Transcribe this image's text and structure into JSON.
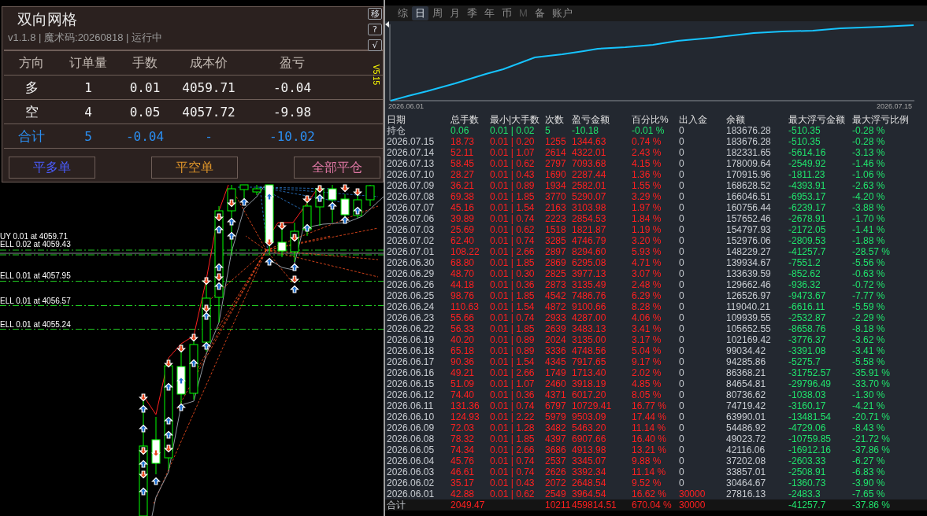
{
  "panel": {
    "title": "双向网格",
    "subtitle": "v1.1.8 | 魔术码:20260818 | 运行中",
    "side_buttons": [
      "移",
      "?",
      "√"
    ],
    "version_tag": "V5.15",
    "table": {
      "columns": [
        "方向",
        "订单量",
        "手数",
        "成本价",
        "盈亏"
      ],
      "rows": [
        {
          "kind": "position",
          "cells": [
            "多",
            "1",
            "0.01",
            "4059.71",
            "-0.04"
          ]
        },
        {
          "kind": "position",
          "cells": [
            "空",
            "4",
            "0.05",
            "4057.72",
            "-9.98"
          ]
        },
        {
          "kind": "total",
          "cells": [
            "合计",
            "5",
            "-0.04",
            "-",
            "-10.02"
          ]
        }
      ]
    },
    "buttons": [
      "平多单",
      "平空单",
      "全部平仓"
    ]
  },
  "chart": {
    "order_labels": [
      "UY 0.01 at 4059.71",
      "ELL 0.02 at 4059.43",
      "ELL 0.01 at 4057.95",
      "ELL 0.01 at 4056.57",
      "ELL 0.01 at 4055.24"
    ]
  },
  "stats": {
    "tabs": [
      {
        "label": "综",
        "selected": false,
        "disabled": false
      },
      {
        "label": "日",
        "selected": true,
        "disabled": false
      },
      {
        "label": "周",
        "selected": false,
        "disabled": false
      },
      {
        "label": "月",
        "selected": false,
        "disabled": false
      },
      {
        "label": "季",
        "selected": false,
        "disabled": false
      },
      {
        "label": "年",
        "selected": false,
        "disabled": false
      },
      {
        "label": "币",
        "selected": false,
        "disabled": false
      },
      {
        "label": "M",
        "selected": false,
        "disabled": true
      },
      {
        "label": "备",
        "selected": false,
        "disabled": false
      },
      {
        "label": "账户",
        "selected": false,
        "disabled": false
      }
    ],
    "equity_chart": {
      "x_start": "2026.06.01",
      "x_end": "2026.07.15"
    },
    "table": {
      "columns": [
        "日期",
        "总手数",
        "最小|大手数",
        "次数",
        "盈亏金额",
        "百分比%",
        "出入金",
        "余额",
        "最大浮亏金额",
        "最大浮亏比例"
      ],
      "rows": [
        {
          "kind": "open",
          "date": "持仓",
          "lots": "0.06",
          "lot_range": "0.01 | 0.02",
          "trades": "5",
          "pnl": "-10.18",
          "percent": "-0.01 %",
          "deposit": "0",
          "deposit_highlighted": false,
          "balance": "183676.28",
          "max_float_loss": "-510.35",
          "max_float_loss_pct": "-0.28 %"
        },
        {
          "kind": "day",
          "date": "2026.07.15",
          "lots": "18.73",
          "lot_range": "0.01 | 0.20",
          "trades": "1255",
          "pnl": "1344.63",
          "percent": "0.74 %",
          "deposit": "0",
          "deposit_highlighted": false,
          "balance": "183676.28",
          "max_float_loss": "-510.35",
          "max_float_loss_pct": "-0.28 %"
        },
        {
          "kind": "day",
          "date": "2026.07.14",
          "lots": "52.11",
          "lot_range": "0.01 | 1.07",
          "trades": "2614",
          "pnl": "4322.01",
          "percent": "2.43 %",
          "deposit": "0",
          "deposit_highlighted": false,
          "balance": "182331.65",
          "max_float_loss": "-5614.16",
          "max_float_loss_pct": "-3.13 %"
        },
        {
          "kind": "day",
          "date": "2026.07.13",
          "lots": "58.45",
          "lot_range": "0.01 | 0.62",
          "trades": "2797",
          "pnl": "7093.68",
          "percent": "4.15 %",
          "deposit": "0",
          "deposit_highlighted": false,
          "balance": "178009.64",
          "max_float_loss": "-2549.92",
          "max_float_loss_pct": "-1.46 %"
        },
        {
          "kind": "day",
          "date": "2026.07.10",
          "lots": "28.27",
          "lot_range": "0.01 | 0.43",
          "trades": "1690",
          "pnl": "2287.44",
          "percent": "1.36 %",
          "deposit": "0",
          "deposit_highlighted": false,
          "balance": "170915.96",
          "max_float_loss": "-1811.23",
          "max_float_loss_pct": "-1.06 %"
        },
        {
          "kind": "day",
          "date": "2026.07.09",
          "lots": "36.21",
          "lot_range": "0.01 | 0.89",
          "trades": "1934",
          "pnl": "2582.01",
          "percent": "1.55 %",
          "deposit": "0",
          "deposit_highlighted": false,
          "balance": "168628.52",
          "max_float_loss": "-4393.91",
          "max_float_loss_pct": "-2.63 %"
        },
        {
          "kind": "day",
          "date": "2026.07.08",
          "lots": "69.38",
          "lot_range": "0.01 | 1.85",
          "trades": "3770",
          "pnl": "5290.07",
          "percent": "3.29 %",
          "deposit": "0",
          "deposit_highlighted": false,
          "balance": "166046.51",
          "max_float_loss": "-6953.17",
          "max_float_loss_pct": "-4.20 %"
        },
        {
          "kind": "day",
          "date": "2026.07.07",
          "lots": "45.16",
          "lot_range": "0.01 | 1.54",
          "trades": "2163",
          "pnl": "3103.98",
          "percent": "1.97 %",
          "deposit": "0",
          "deposit_highlighted": false,
          "balance": "160756.44",
          "max_float_loss": "-6239.17",
          "max_float_loss_pct": "-3.88 %"
        },
        {
          "kind": "day",
          "date": "2026.07.06",
          "lots": "39.89",
          "lot_range": "0.01 | 0.74",
          "trades": "2223",
          "pnl": "2854.53",
          "percent": "1.84 %",
          "deposit": "0",
          "deposit_highlighted": false,
          "balance": "157652.46",
          "max_float_loss": "-2678.91",
          "max_float_loss_pct": "-1.70 %"
        },
        {
          "kind": "day",
          "date": "2026.07.03",
          "lots": "25.69",
          "lot_range": "0.01 | 0.62",
          "trades": "1518",
          "pnl": "1821.87",
          "percent": "1.19 %",
          "deposit": "0",
          "deposit_highlighted": false,
          "balance": "154797.93",
          "max_float_loss": "-2172.05",
          "max_float_loss_pct": "-1.41 %"
        },
        {
          "kind": "day",
          "date": "2026.07.02",
          "lots": "62.40",
          "lot_range": "0.01 | 0.74",
          "trades": "3285",
          "pnl": "4746.79",
          "percent": "3.20 %",
          "deposit": "0",
          "deposit_highlighted": false,
          "balance": "152976.06",
          "max_float_loss": "-2809.53",
          "max_float_loss_pct": "-1.88 %"
        },
        {
          "kind": "day",
          "date": "2026.07.01",
          "lots": "108.22",
          "lot_range": "0.01 | 2.66",
          "trades": "2897",
          "pnl": "8294.60",
          "percent": "5.93 %",
          "deposit": "0",
          "deposit_highlighted": false,
          "balance": "148229.27",
          "max_float_loss": "-41257.7",
          "max_float_loss_pct": "-28.57 %"
        },
        {
          "kind": "day",
          "date": "2026.06.30",
          "lots": "68.80",
          "lot_range": "0.01 | 1.85",
          "trades": "2869",
          "pnl": "6295.08",
          "percent": "4.71 %",
          "deposit": "0",
          "deposit_highlighted": false,
          "balance": "139934.67",
          "max_float_loss": "-7551.2",
          "max_float_loss_pct": "-5.56 %"
        },
        {
          "kind": "day",
          "date": "2026.06.29",
          "lots": "48.70",
          "lot_range": "0.01 | 0.30",
          "trades": "2825",
          "pnl": "3977.13",
          "percent": "3.07 %",
          "deposit": "0",
          "deposit_highlighted": false,
          "balance": "133639.59",
          "max_float_loss": "-852.62",
          "max_float_loss_pct": "-0.63 %"
        },
        {
          "kind": "day",
          "date": "2026.06.26",
          "lots": "44.18",
          "lot_range": "0.01 | 0.36",
          "trades": "2873",
          "pnl": "3135.49",
          "percent": "2.48 %",
          "deposit": "0",
          "deposit_highlighted": false,
          "balance": "129662.46",
          "max_float_loss": "-936.32",
          "max_float_loss_pct": "-0.72 %"
        },
        {
          "kind": "day",
          "date": "2026.06.25",
          "lots": "98.76",
          "lot_range": "0.01 | 1.85",
          "trades": "4542",
          "pnl": "7486.76",
          "percent": "6.29 %",
          "deposit": "0",
          "deposit_highlighted": false,
          "balance": "126526.97",
          "max_float_loss": "-9473.67",
          "max_float_loss_pct": "-7.77 %"
        },
        {
          "kind": "day",
          "date": "2026.06.24",
          "lots": "110.63",
          "lot_range": "0.01 | 1.54",
          "trades": "4872",
          "pnl": "9100.66",
          "percent": "8.28 %",
          "deposit": "0",
          "deposit_highlighted": false,
          "balance": "119040.21",
          "max_float_loss": "-6616.11",
          "max_float_loss_pct": "-5.59 %"
        },
        {
          "kind": "day",
          "date": "2026.06.23",
          "lots": "55.66",
          "lot_range": "0.01 | 0.74",
          "trades": "2933",
          "pnl": "4287.00",
          "percent": "4.06 %",
          "deposit": "0",
          "deposit_highlighted": false,
          "balance": "109939.55",
          "max_float_loss": "-2532.87",
          "max_float_loss_pct": "-2.29 %"
        },
        {
          "kind": "day",
          "date": "2026.06.22",
          "lots": "56.33",
          "lot_range": "0.01 | 1.85",
          "trades": "2639",
          "pnl": "3483.13",
          "percent": "3.41 %",
          "deposit": "0",
          "deposit_highlighted": false,
          "balance": "105652.55",
          "max_float_loss": "-8658.76",
          "max_float_loss_pct": "-8.18 %"
        },
        {
          "kind": "day",
          "date": "2026.06.19",
          "lots": "40.20",
          "lot_range": "0.01 | 0.89",
          "trades": "2024",
          "pnl": "3135.00",
          "percent": "3.17 %",
          "deposit": "0",
          "deposit_highlighted": false,
          "balance": "102169.42",
          "max_float_loss": "-3776.37",
          "max_float_loss_pct": "-3.62 %"
        },
        {
          "kind": "day",
          "date": "2026.06.18",
          "lots": "65.18",
          "lot_range": "0.01 | 0.89",
          "trades": "3336",
          "pnl": "4748.56",
          "percent": "5.04 %",
          "deposit": "0",
          "deposit_highlighted": false,
          "balance": "99034.42",
          "max_float_loss": "-3391.08",
          "max_float_loss_pct": "-3.41 %"
        },
        {
          "kind": "day",
          "date": "2026.06.17",
          "lots": "90.36",
          "lot_range": "0.01 | 1.54",
          "trades": "4345",
          "pnl": "7917.65",
          "percent": "9.17 %",
          "deposit": "0",
          "deposit_highlighted": false,
          "balance": "94285.86",
          "max_float_loss": "-5275.7",
          "max_float_loss_pct": "-5.58 %"
        },
        {
          "kind": "day",
          "date": "2026.06.16",
          "lots": "49.21",
          "lot_range": "0.01 | 2.66",
          "trades": "1749",
          "pnl": "1713.40",
          "percent": "2.02 %",
          "deposit": "0",
          "deposit_highlighted": false,
          "balance": "86368.21",
          "max_float_loss": "-31752.57",
          "max_float_loss_pct": "-35.91 %"
        },
        {
          "kind": "day",
          "date": "2026.06.15",
          "lots": "51.09",
          "lot_range": "0.01 | 1.07",
          "trades": "2460",
          "pnl": "3918.19",
          "percent": "4.85 %",
          "deposit": "0",
          "deposit_highlighted": false,
          "balance": "84654.81",
          "max_float_loss": "-29796.49",
          "max_float_loss_pct": "-33.70 %"
        },
        {
          "kind": "day",
          "date": "2026.06.12",
          "lots": "74.40",
          "lot_range": "0.01 | 0.36",
          "trades": "4371",
          "pnl": "6017.20",
          "percent": "8.05 %",
          "deposit": "0",
          "deposit_highlighted": false,
          "balance": "80736.62",
          "max_float_loss": "-1038.03",
          "max_float_loss_pct": "-1.30 %"
        },
        {
          "kind": "day",
          "date": "2026.06.11",
          "lots": "131.36",
          "lot_range": "0.01 | 0.74",
          "trades": "6797",
          "pnl": "10729.41",
          "percent": "16.77 %",
          "deposit": "0",
          "deposit_highlighted": false,
          "balance": "74719.42",
          "max_float_loss": "-3160.17",
          "max_float_loss_pct": "-4.21 %"
        },
        {
          "kind": "day",
          "date": "2026.06.10",
          "lots": "124.93",
          "lot_range": "0.01 | 2.22",
          "trades": "5979",
          "pnl": "9503.09",
          "percent": "17.44 %",
          "deposit": "0",
          "deposit_highlighted": false,
          "balance": "63990.01",
          "max_float_loss": "-13481.54",
          "max_float_loss_pct": "-20.71 %"
        },
        {
          "kind": "day",
          "date": "2026.06.09",
          "lots": "72.03",
          "lot_range": "0.01 | 1.28",
          "trades": "3482",
          "pnl": "5463.20",
          "percent": "11.14 %",
          "deposit": "0",
          "deposit_highlighted": false,
          "balance": "54486.92",
          "max_float_loss": "-4729.06",
          "max_float_loss_pct": "-8.43 %"
        },
        {
          "kind": "day",
          "date": "2026.06.08",
          "lots": "78.32",
          "lot_range": "0.01 | 1.85",
          "trades": "4397",
          "pnl": "6907.66",
          "percent": "16.40 %",
          "deposit": "0",
          "deposit_highlighted": false,
          "balance": "49023.72",
          "max_float_loss": "-10759.85",
          "max_float_loss_pct": "-21.72 %"
        },
        {
          "kind": "day",
          "date": "2026.06.05",
          "lots": "74.34",
          "lot_range": "0.01 | 2.66",
          "trades": "3686",
          "pnl": "4913.98",
          "percent": "13.21 %",
          "deposit": "0",
          "deposit_highlighted": false,
          "balance": "42116.06",
          "max_float_loss": "-16912.16",
          "max_float_loss_pct": "-37.86 %"
        },
        {
          "kind": "day",
          "date": "2026.06.04",
          "lots": "45.76",
          "lot_range": "0.01 | 0.74",
          "trades": "2537",
          "pnl": "3345.07",
          "percent": "9.88 %",
          "deposit": "0",
          "deposit_highlighted": false,
          "balance": "37202.08",
          "max_float_loss": "-2603.33",
          "max_float_loss_pct": "-6.27 %"
        },
        {
          "kind": "day",
          "date": "2026.06.03",
          "lots": "46.61",
          "lot_range": "0.01 | 0.74",
          "trades": "2626",
          "pnl": "3392.34",
          "percent": "11.14 %",
          "deposit": "0",
          "deposit_highlighted": false,
          "balance": "33857.01",
          "max_float_loss": "-2508.91",
          "max_float_loss_pct": "-6.83 %"
        },
        {
          "kind": "day",
          "date": "2026.06.02",
          "lots": "35.17",
          "lot_range": "0.01 | 0.43",
          "trades": "2072",
          "pnl": "2648.54",
          "percent": "9.52 %",
          "deposit": "0",
          "deposit_highlighted": false,
          "balance": "30464.67",
          "max_float_loss": "-1360.73",
          "max_float_loss_pct": "-3.90 %"
        },
        {
          "kind": "day",
          "date": "2026.06.01",
          "lots": "42.88",
          "lot_range": "0.01 | 0.62",
          "trades": "2549",
          "pnl": "3964.54",
          "percent": "16.62 %",
          "deposit": "30000",
          "deposit_highlighted": true,
          "balance": "27816.13",
          "max_float_loss": "-2483.3",
          "max_float_loss_pct": "-7.65 %"
        },
        {
          "kind": "total",
          "date": "合计",
          "lots": "2049.47",
          "trades": "10211",
          "pnl": "459814.51",
          "percent": "670.04 %",
          "deposit": "30000",
          "deposit_highlighted": true,
          "max_float_loss": "-41257.7",
          "max_float_loss_pct": "-37.86 %"
        }
      ]
    }
  }
}
